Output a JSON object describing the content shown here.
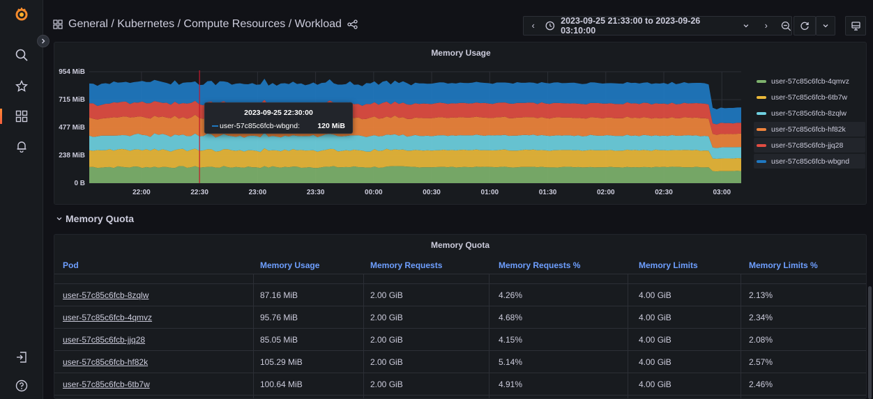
{
  "sidebar": {
    "logo": "grafana-logo",
    "items": [
      "search-icon",
      "star-icon",
      "dashboards-icon",
      "alerting-icon"
    ],
    "bottom_items": [
      "sign-in-icon",
      "help-icon"
    ]
  },
  "topbar": {
    "breadcrumb": "General / Kubernetes / Compute Resources / Workload",
    "time_range": "2023-09-25 21:33:00 to 2023-09-26 03:10:00"
  },
  "chart_panel": {
    "title": "Memory Usage",
    "tooltip": {
      "time": "2023-09-25 22:30:00",
      "series": "user-57c85c6fcb-wbgnd:",
      "value": "120 MiB",
      "color": "#1f78c1"
    }
  },
  "chart_data": {
    "type": "area",
    "stacked": true,
    "title": "Memory Usage",
    "y_ticks": [
      "0 B",
      "238 MiB",
      "477 MiB",
      "715 MiB",
      "954 MiB"
    ],
    "y_tick_values": [
      0,
      238,
      477,
      715,
      954
    ],
    "ylim": [
      0,
      954
    ],
    "x_ticks": [
      "22:00",
      "22:30",
      "23:00",
      "23:30",
      "00:00",
      "00:30",
      "01:00",
      "01:30",
      "02:00",
      "02:30",
      "03:00"
    ],
    "x_range": [
      "21:33",
      "03:10"
    ],
    "legend_position": "right",
    "series": [
      {
        "name": "user-57c85c6fcb-4qmvz",
        "color": "#7eb26d",
        "approx_mib": 95
      },
      {
        "name": "user-57c85c6fcb-6tb7w",
        "color": "#eab839",
        "approx_mib": 100
      },
      {
        "name": "user-57c85c6fcb-8zqlw",
        "color": "#6ed0e0",
        "approx_mib": 87
      },
      {
        "name": "user-57c85c6fcb-hf82k",
        "color": "#ef843c",
        "approx_mib": 105
      },
      {
        "name": "user-57c85c6fcb-jjq28",
        "color": "#e24d42",
        "approx_mib": 85
      },
      {
        "name": "user-57c85c6fcb-wbgnd",
        "color": "#1f78c1",
        "approx_mib": 120
      }
    ],
    "cursor_x": "22:30"
  },
  "row": {
    "title": "Memory Quota"
  },
  "table": {
    "title": "Memory Quota",
    "columns": [
      "Pod",
      "Memory Usage",
      "Memory Requests",
      "Memory Requests %",
      "Memory Limits",
      "Memory Limits %"
    ],
    "rows": [
      [
        "user-57c85c6fcb-8zqlw",
        "87.16 MiB",
        "2.00 GiB",
        "4.26%",
        "4.00 GiB",
        "2.13%"
      ],
      [
        "user-57c85c6fcb-4qmvz",
        "95.76 MiB",
        "2.00 GiB",
        "4.68%",
        "4.00 GiB",
        "2.34%"
      ],
      [
        "user-57c85c6fcb-jjq28",
        "85.05 MiB",
        "2.00 GiB",
        "4.15%",
        "4.00 GiB",
        "2.08%"
      ],
      [
        "user-57c85c6fcb-hf82k",
        "105.29 MiB",
        "2.00 GiB",
        "5.14%",
        "4.00 GiB",
        "2.57%"
      ],
      [
        "user-57c85c6fcb-6tb7w",
        "100.64 MiB",
        "2.00 GiB",
        "4.91%",
        "4.00 GiB",
        "2.46%"
      ]
    ]
  }
}
